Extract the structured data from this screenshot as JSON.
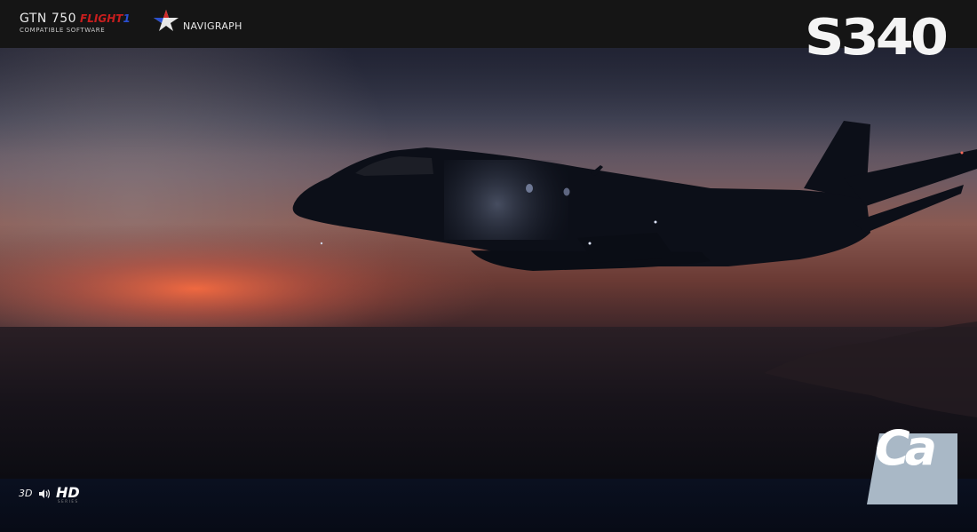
{
  "header": {
    "gtn_title": "GTN 750",
    "gtn_flight": "FLIGHT",
    "gtn_flight_mark": "1",
    "gtn_subtitle": "COMPATIBLE SOFTWARE",
    "navigraph_label": "NAVIGRAPH",
    "product_title": "S340"
  },
  "footer": {
    "badge_3d": "3D",
    "badge_hd": "HD",
    "badge_series": "SERIES",
    "ca_logo_text": "Ca"
  },
  "colors": {
    "topbar": "#151515",
    "sunset_glow": "#f0653f",
    "sky_top": "#3c4051",
    "sea": "#1a1419",
    "aircraft_silhouette": "#0c0f18",
    "flight_red": "#c81e1e",
    "flight_blue": "#2a4fd0",
    "ca_logo_bg": "#a9b8c6"
  },
  "icons": [
    "navigraph-star-icon",
    "sound-waves-icon",
    "ca-logo"
  ]
}
